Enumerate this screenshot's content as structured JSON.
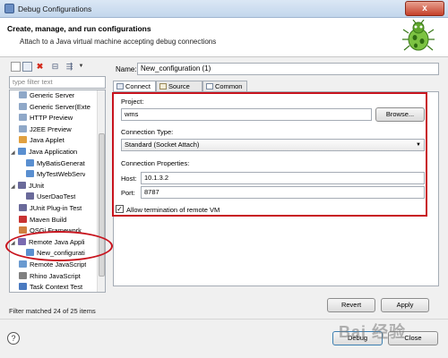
{
  "window": {
    "title": "Debug Configurations",
    "close_label": "x"
  },
  "header": {
    "title": "Create, manage, and run configurations",
    "subtitle": "Attach to a Java virtual machine accepting debug connections"
  },
  "left": {
    "filter_placeholder": "type filter text",
    "tree": [
      {
        "label": "Generic Server",
        "level": 1,
        "icon": "server-icon"
      },
      {
        "label": "Generic Server(Exte",
        "level": 1,
        "icon": "server-icon"
      },
      {
        "label": "HTTP Preview",
        "level": 1,
        "icon": "server-icon"
      },
      {
        "label": "J2EE Preview",
        "level": 1,
        "icon": "server-icon"
      },
      {
        "label": "Java Applet",
        "level": 1,
        "icon": "applet-icon"
      },
      {
        "label": "Java Application",
        "level": 0,
        "icon": "java-app-icon"
      },
      {
        "label": "MyBatisGenerat",
        "level": 2,
        "icon": "java-app-icon"
      },
      {
        "label": "MyTestWebServ",
        "level": 2,
        "icon": "java-app-icon"
      },
      {
        "label": "JUnit",
        "level": 0,
        "icon": "junit-icon"
      },
      {
        "label": "UserDaoTest",
        "level": 2,
        "icon": "junit-icon"
      },
      {
        "label": "JUnit Plug-in Test",
        "level": 1,
        "icon": "junit-plugin-icon"
      },
      {
        "label": "Maven Build",
        "level": 1,
        "icon": "maven-icon"
      },
      {
        "label": "OSGi Framework",
        "level": 1,
        "icon": "osgi-icon"
      },
      {
        "label": "Remote Java Appli",
        "level": 0,
        "icon": "remote-java-icon"
      },
      {
        "label": "New_configurati",
        "level": 2,
        "icon": "java-app-icon"
      },
      {
        "label": "Remote JavaScript",
        "level": 1,
        "icon": "remote-js-icon"
      },
      {
        "label": "Rhino JavaScript",
        "level": 1,
        "icon": "rhino-icon"
      },
      {
        "label": "Task Context Test",
        "level": 1,
        "icon": "task-icon"
      }
    ],
    "status": "Filter matched 24 of 25 items"
  },
  "config": {
    "name_label": "Name:",
    "name_value": "New_configuration (1)",
    "tabs": [
      "Connect",
      "Source",
      "Common"
    ],
    "project_label": "Project:",
    "project_value": "wms",
    "browse_label": "Browse...",
    "connection_type_label": "Connection Type:",
    "connection_type_value": "Standard (Socket Attach)",
    "connection_props_label": "Connection Properties:",
    "host_label": "Host:",
    "host_value": "10.1.3.2",
    "port_label": "Port:",
    "port_value": "8787",
    "allow_termination_label": "Allow termination of remote VM",
    "allow_termination_checked": true,
    "revert_label": "Revert",
    "apply_label": "Apply"
  },
  "footer": {
    "debug_label": "Debug",
    "close_label": "Close",
    "help_label": "?"
  },
  "watermark": {
    "text": "Bai 经验"
  },
  "colors": {
    "highlight_red": "#c8141e",
    "panel_border": "#a5acb5"
  }
}
